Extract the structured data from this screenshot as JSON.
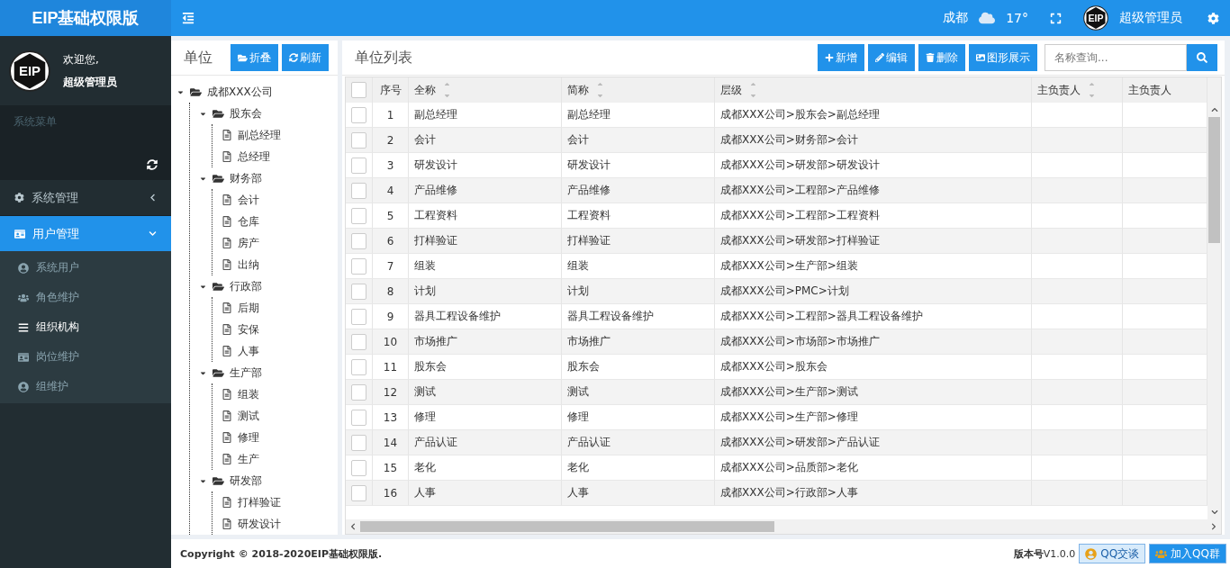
{
  "brand": {
    "title": "EIP基础权限版"
  },
  "user_panel": {
    "logo_text": "EIP",
    "greeting": "欢迎您,",
    "name": "超级管理员"
  },
  "menu_header": {
    "label": "系统菜单"
  },
  "menu": [
    {
      "label": "系统管理",
      "expanded": false,
      "selected": false
    },
    {
      "label": "用户管理",
      "expanded": true,
      "selected": true,
      "children": [
        {
          "label": "系统用户",
          "selected": false
        },
        {
          "label": "角色维护",
          "selected": false
        },
        {
          "label": "组织机构",
          "selected": true
        },
        {
          "label": "岗位维护",
          "selected": false
        },
        {
          "label": "组维护",
          "selected": false
        }
      ]
    }
  ],
  "topbar": {
    "city": "成都",
    "temperature": "17°",
    "logo_text": "EIP",
    "user": "超级管理员"
  },
  "tree_panel": {
    "title": "单位",
    "buttons": [
      "折叠",
      "刷新"
    ],
    "tree": [
      {
        "label": "成都XXX公司",
        "expanded": true,
        "children": [
          {
            "label": "股东会",
            "expanded": true,
            "children": [
              {
                "label": "副总经理"
              },
              {
                "label": "总经理"
              }
            ]
          },
          {
            "label": "财务部",
            "expanded": true,
            "children": [
              {
                "label": "会计"
              },
              {
                "label": "仓库"
              },
              {
                "label": "房产"
              },
              {
                "label": "出纳"
              }
            ]
          },
          {
            "label": "行政部",
            "expanded": true,
            "children": [
              {
                "label": "后期"
              },
              {
                "label": "安保"
              },
              {
                "label": "人事"
              }
            ]
          },
          {
            "label": "生产部",
            "expanded": true,
            "children": [
              {
                "label": "组装"
              },
              {
                "label": "测试"
              },
              {
                "label": "修理"
              },
              {
                "label": "生产"
              }
            ]
          },
          {
            "label": "研发部",
            "expanded": true,
            "children": [
              {
                "label": "打样验证"
              },
              {
                "label": "研发设计"
              }
            ]
          }
        ]
      }
    ]
  },
  "list_panel": {
    "title": "单位列表",
    "buttons": [
      {
        "kind": "add",
        "label": "新增"
      },
      {
        "kind": "edit",
        "label": "编辑"
      },
      {
        "kind": "delete",
        "label": "删除"
      },
      {
        "kind": "chart",
        "label": "图形展示"
      }
    ],
    "search": {
      "placeholder": "名称查询..."
    }
  },
  "table": {
    "select_all": {
      "checked": false
    },
    "columns": [
      "序号",
      "全称",
      "简称",
      "层级",
      "主负责人",
      "主负责人"
    ],
    "rows": [
      {
        "no": "1",
        "full": "副总经理",
        "short": "副总经理",
        "path": "成都XXX公司>股东会>副总经理",
        "checked": false
      },
      {
        "no": "2",
        "full": "会计",
        "short": "会计",
        "path": "成都XXX公司>财务部>会计",
        "checked": false
      },
      {
        "no": "3",
        "full": "研发设计",
        "short": "研发设计",
        "path": "成都XXX公司>研发部>研发设计",
        "checked": false
      },
      {
        "no": "4",
        "full": "产品维修",
        "short": "产品维修",
        "path": "成都XXX公司>工程部>产品维修",
        "checked": false
      },
      {
        "no": "5",
        "full": "工程资料",
        "short": "工程资料",
        "path": "成都XXX公司>工程部>工程资料",
        "checked": false
      },
      {
        "no": "6",
        "full": "打样验证",
        "short": "打样验证",
        "path": "成都XXX公司>研发部>打样验证",
        "checked": false
      },
      {
        "no": "7",
        "full": "组装",
        "short": "组装",
        "path": "成都XXX公司>生产部>组装",
        "checked": false
      },
      {
        "no": "8",
        "full": "计划",
        "short": "计划",
        "path": "成都XXX公司>PMC>计划",
        "checked": false
      },
      {
        "no": "9",
        "full": "器具工程设备维护",
        "short": "器具工程设备维护",
        "path": "成都XXX公司>工程部>器具工程设备维护",
        "checked": false
      },
      {
        "no": "10",
        "full": "市场推广",
        "short": "市场推广",
        "path": "成都XXX公司>市场部>市场推广",
        "checked": false
      },
      {
        "no": "11",
        "full": "股东会",
        "short": "股东会",
        "path": "成都XXX公司>股东会",
        "checked": false
      },
      {
        "no": "12",
        "full": "测试",
        "short": "测试",
        "path": "成都XXX公司>生产部>测试",
        "checked": false
      },
      {
        "no": "13",
        "full": "修理",
        "short": "修理",
        "path": "成都XXX公司>生产部>修理",
        "checked": false
      },
      {
        "no": "14",
        "full": "产品认证",
        "short": "产品认证",
        "path": "成都XXX公司>研发部>产品认证",
        "checked": false
      },
      {
        "no": "15",
        "full": "老化",
        "short": "老化",
        "path": "成都XXX公司>品质部>老化",
        "checked": false
      },
      {
        "no": "16",
        "full": "人事",
        "short": "人事",
        "path": "成都XXX公司>行政部>人事",
        "checked": false
      }
    ]
  },
  "footer": {
    "copyright_prefix": "Copyright © 2018-2020",
    "copyright_brand": "EIP基础权限版.",
    "version_label": "版本号",
    "version": "V1.0.0",
    "buttons": [
      "QQ交谈",
      "加入QQ群"
    ]
  }
}
